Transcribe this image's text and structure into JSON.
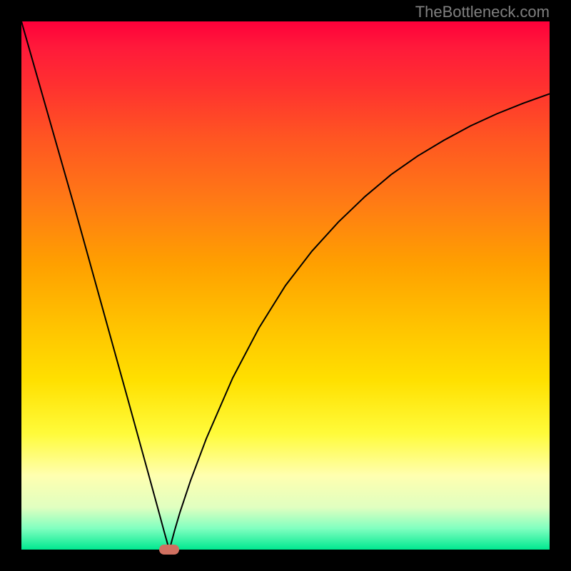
{
  "watermark": "TheBottleneck.com",
  "chart_data": {
    "type": "line",
    "title": "",
    "xlabel": "",
    "ylabel": "",
    "xlim": [
      0,
      100
    ],
    "ylim": [
      0,
      100
    ],
    "min_x": 28,
    "series": [
      {
        "name": "curve",
        "points": [
          {
            "x": 0,
            "y": 100
          },
          {
            "x": 2,
            "y": 93
          },
          {
            "x": 5,
            "y": 82.5
          },
          {
            "x": 10,
            "y": 65
          },
          {
            "x": 15,
            "y": 47
          },
          {
            "x": 20,
            "y": 29
          },
          {
            "x": 24,
            "y": 14.5
          },
          {
            "x": 26,
            "y": 7.2
          },
          {
            "x": 27,
            "y": 3.5
          },
          {
            "x": 27.7,
            "y": 1
          },
          {
            "x": 28,
            "y": 0
          },
          {
            "x": 28.3,
            "y": 1
          },
          {
            "x": 29,
            "y": 3.6
          },
          {
            "x": 30,
            "y": 7
          },
          {
            "x": 32,
            "y": 13
          },
          {
            "x": 35,
            "y": 21
          },
          {
            "x": 40,
            "y": 32.5
          },
          {
            "x": 45,
            "y": 42
          },
          {
            "x": 50,
            "y": 50
          },
          {
            "x": 55,
            "y": 56.5
          },
          {
            "x": 60,
            "y": 62
          },
          {
            "x": 65,
            "y": 66.8
          },
          {
            "x": 70,
            "y": 71
          },
          {
            "x": 75,
            "y": 74.5
          },
          {
            "x": 80,
            "y": 77.5
          },
          {
            "x": 85,
            "y": 80.2
          },
          {
            "x": 90,
            "y": 82.5
          },
          {
            "x": 95,
            "y": 84.5
          },
          {
            "x": 100,
            "y": 86.3
          }
        ]
      }
    ],
    "marker": {
      "x": 28,
      "y": 0
    }
  }
}
